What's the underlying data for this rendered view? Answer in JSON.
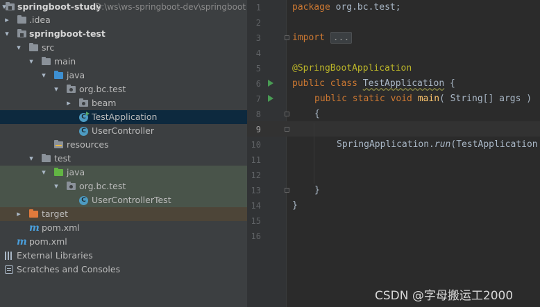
{
  "project": {
    "root_name": "springboot-study",
    "root_path": "D:\\ws\\ws-springboot-dev\\springboot",
    "items": [
      {
        "label": "springboot-study"
      },
      {
        "label": ".idea"
      },
      {
        "label": "springboot-test"
      },
      {
        "label": "src"
      },
      {
        "label": "main"
      },
      {
        "label": "java"
      },
      {
        "label": "org.bc.test"
      },
      {
        "label": "beam"
      },
      {
        "label": "TestApplication"
      },
      {
        "label": "UserController"
      },
      {
        "label": "resources"
      },
      {
        "label": "test"
      },
      {
        "label": "java"
      },
      {
        "label": "org.bc.test"
      },
      {
        "label": "UserControllerTest"
      },
      {
        "label": "target"
      },
      {
        "label": "pom.xml"
      },
      {
        "label": "pom.xml"
      },
      {
        "label": "External Libraries"
      },
      {
        "label": "Scratches and Consoles"
      }
    ]
  },
  "editor": {
    "line_numbers": [
      "1",
      "2",
      "3",
      "4",
      "5",
      "6",
      "7",
      "8",
      "9",
      "10",
      "11",
      "12",
      "13",
      "14",
      "15",
      "16"
    ],
    "current_line": "10",
    "code": {
      "l1_kw": "package",
      "l1_rest": " org.bc.test;",
      "l3_kw": "import",
      "l3_fold": "...",
      "l6_annotation": "@SpringBootApplication",
      "l7_kw": "public class ",
      "l7_name": "TestApplication",
      "l7_rest": " {",
      "l8_kw": "public static void ",
      "l8_fn": "main",
      "l8_rest": "( String[] args )",
      "l9": "{",
      "l11_a": "SpringApplication.",
      "l11_b": "run",
      "l11_c": "(TestApplication",
      "l14": "}",
      "l15": "}"
    }
  },
  "watermark": "CSDN @字母搬运工2000",
  "colors": {
    "tree_bg": "#3c3f41",
    "editor_bg": "#2b2b2b",
    "selected_row": "#0d293e",
    "keyword": "#cc7832",
    "annotation": "#bbb529",
    "method": "#ffc66d",
    "text": "#a9b7c6"
  },
  "icons": [
    "chevron-right-icon",
    "chevron-down-icon",
    "folder-icon",
    "module-icon",
    "package-icon",
    "class-icon",
    "maven-icon",
    "libraries-icon",
    "scratches-icon",
    "run-icon",
    "fold-icon"
  ]
}
